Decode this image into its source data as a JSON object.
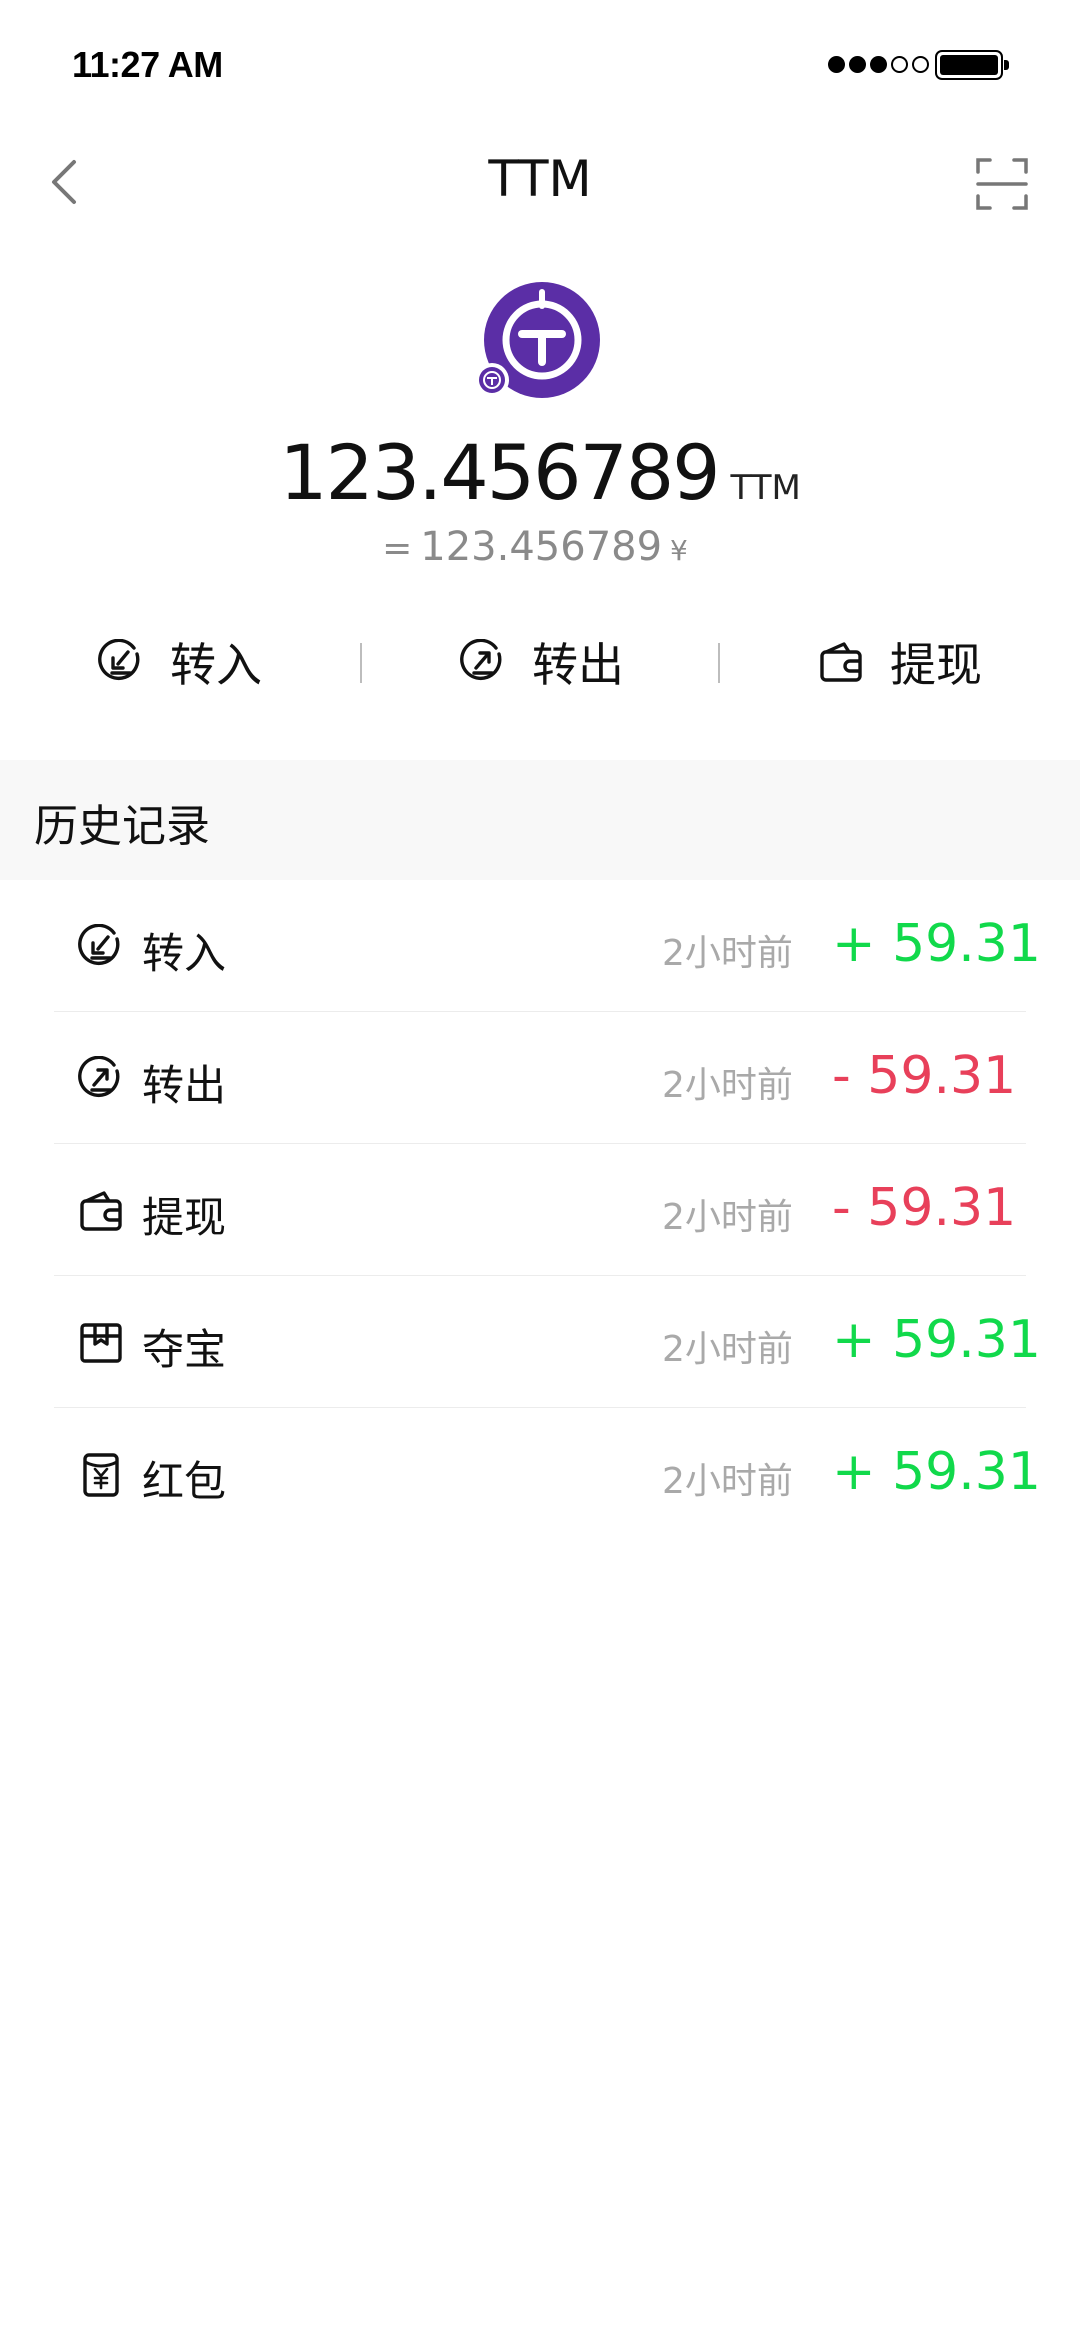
{
  "status_bar": {
    "time": "11:27 AM",
    "signal_bars_filled": 3,
    "signal_bars_total": 5,
    "battery_level": 1.0
  },
  "nav": {
    "title": "TTM",
    "back_icon": "chevron-left-icon",
    "scan_icon": "scan-icon"
  },
  "coin": {
    "logo_color": "#5b2ea6",
    "balance": "123.456789",
    "unit": "TTM",
    "fiat_prefix": "=",
    "fiat_value": "123.456789",
    "fiat_unit": "¥"
  },
  "actions": [
    {
      "label": "转入",
      "icon": "receive-icon"
    },
    {
      "label": "转出",
      "icon": "send-icon"
    },
    {
      "label": "提现",
      "icon": "wallet-icon"
    }
  ],
  "history": {
    "title": "历史记录",
    "items": [
      {
        "label": "转入",
        "time": "2小时前",
        "amount": "+ 59.31",
        "sign": "positive",
        "icon": "receive-icon"
      },
      {
        "label": "转出",
        "time": "2小时前",
        "amount": "- 59.31",
        "sign": "negative",
        "icon": "send-icon"
      },
      {
        "label": "提现",
        "time": "2小时前",
        "amount": "- 59.31",
        "sign": "negative",
        "icon": "wallet-icon"
      },
      {
        "label": "夺宝",
        "time": "2小时前",
        "amount": "+ 59.31",
        "sign": "positive",
        "icon": "treasure-box-icon"
      },
      {
        "label": "红包",
        "time": "2小时前",
        "amount": "+ 59.31",
        "sign": "positive",
        "icon": "red-packet-icon"
      }
    ]
  },
  "colors": {
    "positive": "#11d94b",
    "negative": "#e8405a",
    "muted": "#a9a9a9",
    "section_bg": "#f8f8f8"
  }
}
